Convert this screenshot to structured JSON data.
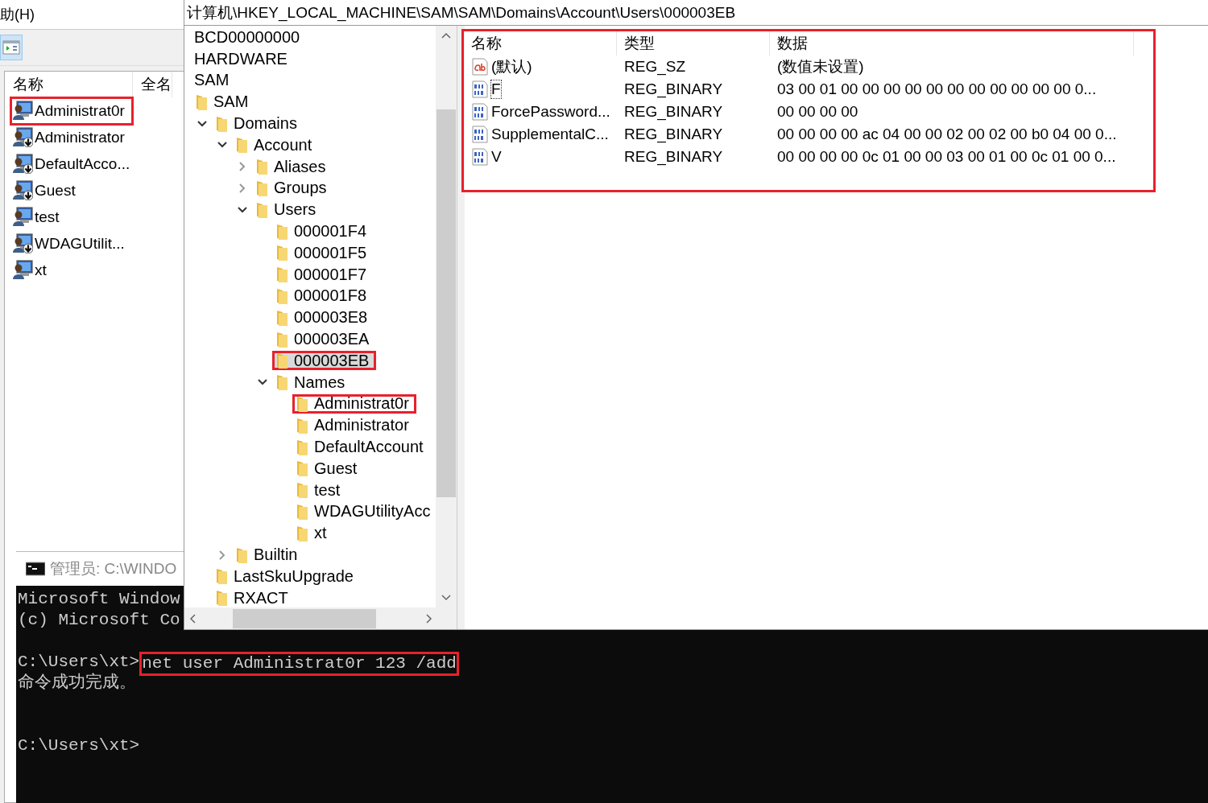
{
  "left_window": {
    "menu_item": "助(H)",
    "list": {
      "columns": [
        "名称",
        "全名"
      ],
      "rows": [
        {
          "name": "Administrat0r",
          "disabled": false,
          "annotated": true
        },
        {
          "name": "Administrator",
          "disabled": true,
          "annotated": false
        },
        {
          "name": "DefaultAcco...",
          "disabled": true,
          "annotated": false
        },
        {
          "name": "Guest",
          "disabled": true,
          "annotated": false
        },
        {
          "name": "test",
          "disabled": false,
          "annotated": false
        },
        {
          "name": "WDAGUtilit...",
          "disabled": true,
          "annotated": false
        },
        {
          "name": "xt",
          "disabled": false,
          "annotated": false
        }
      ]
    }
  },
  "registry": {
    "address": "计算机\\HKEY_LOCAL_MACHINE\\SAM\\SAM\\Domains\\Account\\Users\\000003EB",
    "tree": [
      {
        "label": "BCD00000000",
        "selected": false
      },
      {
        "label": "HARDWARE",
        "selected": false
      },
      {
        "label": "SAM",
        "selected": false,
        "children": [
          {
            "label": "SAM",
            "selected": false,
            "children": [
              {
                "label": "Domains",
                "selected": false,
                "expanded": true,
                "children": [
                  {
                    "label": "Account",
                    "selected": false,
                    "expanded": true,
                    "children": [
                      {
                        "label": "Aliases",
                        "selected": false,
                        "expanded": false
                      },
                      {
                        "label": "Groups",
                        "selected": false,
                        "expanded": false
                      },
                      {
                        "label": "Users",
                        "selected": false,
                        "expanded": true,
                        "children": [
                          {
                            "label": "000001F4",
                            "selected": false
                          },
                          {
                            "label": "000001F5",
                            "selected": false
                          },
                          {
                            "label": "000001F7",
                            "selected": false
                          },
                          {
                            "label": "000001F8",
                            "selected": false
                          },
                          {
                            "label": "000003E8",
                            "selected": false
                          },
                          {
                            "label": "000003EA",
                            "selected": false
                          },
                          {
                            "label": "000003EB",
                            "selected": true,
                            "annotated": true
                          },
                          {
                            "label": "Names",
                            "selected": false,
                            "expanded": true,
                            "children": [
                              {
                                "label": "Administrat0r",
                                "selected": false,
                                "annotated": true
                              },
                              {
                                "label": "Administrator",
                                "selected": false
                              },
                              {
                                "label": "DefaultAccount",
                                "selected": false
                              },
                              {
                                "label": "Guest",
                                "selected": false
                              },
                              {
                                "label": "test",
                                "selected": false
                              },
                              {
                                "label": "WDAGUtilityAcc",
                                "selected": false
                              },
                              {
                                "label": "xt",
                                "selected": false
                              }
                            ]
                          }
                        ]
                      }
                    ]
                  },
                  {
                    "label": "Builtin",
                    "selected": false,
                    "expanded": false
                  }
                ]
              },
              {
                "label": "LastSkuUpgrade",
                "selected": false
              },
              {
                "label": "RXACT",
                "selected": false
              }
            ]
          }
        ]
      }
    ],
    "values": {
      "annotated": true,
      "columns": [
        "名称",
        "类型",
        "数据"
      ],
      "rows": [
        {
          "kind": "string",
          "name": "(默认)",
          "type": "REG_SZ",
          "data": "(数值未设置)",
          "focused": false
        },
        {
          "kind": "binary",
          "name": "F",
          "type": "REG_BINARY",
          "data": "03 00 01 00 00 00 00 00 00 00 00 00 00 00 0...",
          "focused": true
        },
        {
          "kind": "binary",
          "name": "ForcePassword...",
          "type": "REG_BINARY",
          "data": "00 00 00 00",
          "focused": false
        },
        {
          "kind": "binary",
          "name": "SupplementalC...",
          "type": "REG_BINARY",
          "data": "00 00 00 00 ac 04 00 00 02 00 02 00 b0 04 00 0...",
          "focused": false
        },
        {
          "kind": "binary",
          "name": "V",
          "type": "REG_BINARY",
          "data": "00 00 00 00 0c 01 00 00 03 00 01 00 0c 01 00 0...",
          "focused": false
        }
      ]
    }
  },
  "console": {
    "title": "管理员: C:\\WINDO",
    "lines": [
      {
        "kind": "text",
        "text": "Microsoft Window"
      },
      {
        "kind": "text",
        "text": "(c) Microsoft Co"
      },
      {
        "kind": "blank"
      },
      {
        "kind": "command",
        "prompt": "C:\\Users\\xt>",
        "command": "net user Administrat0r 123 /add",
        "annotated": true
      },
      {
        "kind": "text",
        "text": "命令成功完成。"
      },
      {
        "kind": "blank"
      },
      {
        "kind": "blank"
      },
      {
        "kind": "text",
        "text": "C:\\Users\\xt>"
      }
    ]
  }
}
